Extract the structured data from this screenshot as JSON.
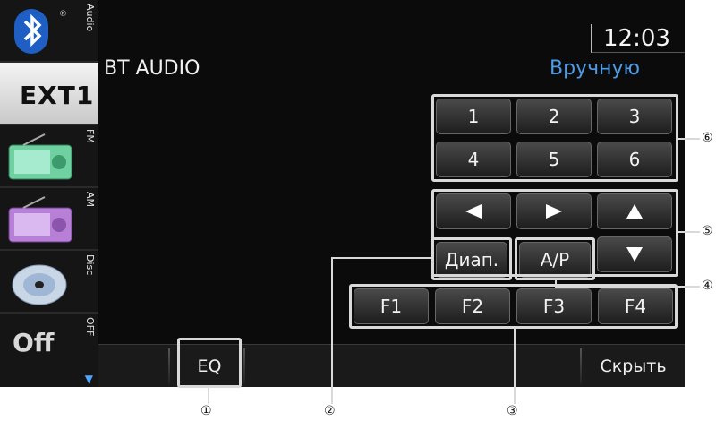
{
  "sidebar": {
    "items": [
      {
        "name": "audio-source",
        "label": "Audio"
      },
      {
        "name": "ext1-source",
        "label": "EXT1"
      },
      {
        "name": "fm-source",
        "label": "FM"
      },
      {
        "name": "am-source",
        "label": "AM"
      },
      {
        "name": "disc-source",
        "label": "Disc"
      },
      {
        "name": "off-source",
        "label": "OFF",
        "text": "Off"
      }
    ]
  },
  "header": {
    "title": "BT AUDIO",
    "mode": "Вручную",
    "clock": "12:03"
  },
  "keypad": [
    "1",
    "2",
    "3",
    "4",
    "5",
    "6"
  ],
  "buttons": {
    "diap": "Диап.",
    "ap": "A/P"
  },
  "function_keys": [
    "F1",
    "F2",
    "F3",
    "F4"
  ],
  "bottombar": {
    "eq": "EQ",
    "hide": "Скрыть"
  },
  "callouts": [
    "①",
    "②",
    "③",
    "④",
    "⑤",
    "⑥"
  ],
  "colors": {
    "accent_blue": "#4d9ce8",
    "background": "#0b0b0b"
  }
}
